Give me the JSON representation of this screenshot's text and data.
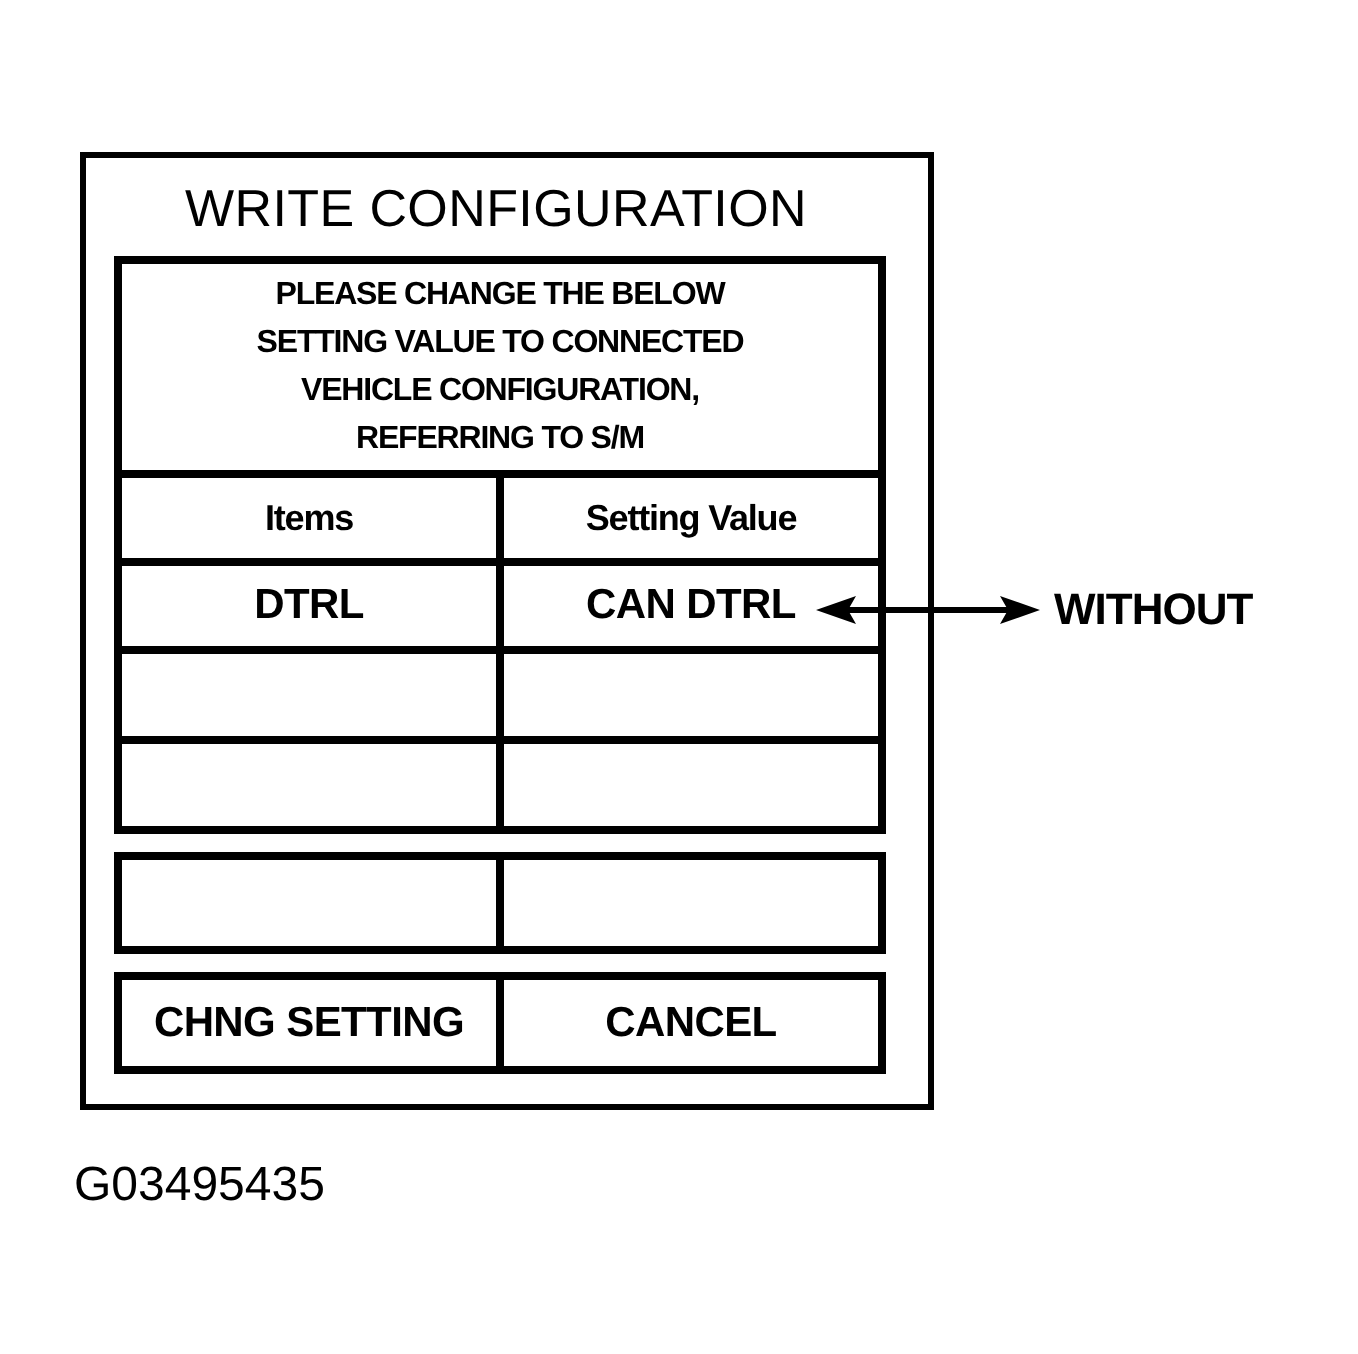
{
  "dialog": {
    "title": "WRITE CONFIGURATION",
    "message_lines": [
      "PLEASE CHANGE THE BELOW",
      "SETTING VALUE TO CONNECTED",
      "VEHICLE CONFIGURATION,",
      "REFERRING TO S/M"
    ],
    "table": {
      "columns": [
        "Items",
        "Setting Value"
      ],
      "rows": [
        [
          "DTRL",
          "CAN DTRL"
        ]
      ]
    },
    "buttons": [
      "CHNG SETTING",
      "CANCEL"
    ]
  },
  "callout": {
    "label": "WITHOUT"
  },
  "figure_id": "G03495435"
}
